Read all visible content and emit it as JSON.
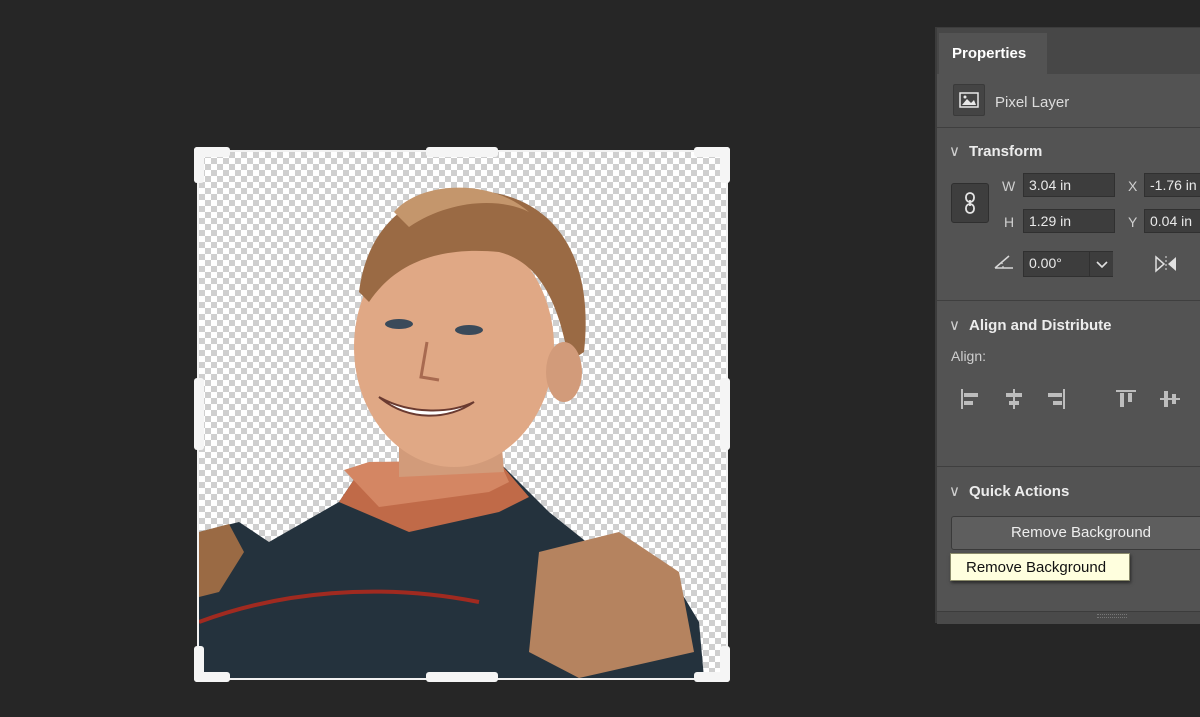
{
  "properties_panel": {
    "tab_label": "Properties",
    "layer_type": "Pixel Layer",
    "transform": {
      "title": "Transform",
      "w_label": "W",
      "w_value": "3.04 in",
      "h_label": "H",
      "h_value": "1.29 in",
      "x_label": "X",
      "x_value": "-1.76 in",
      "y_label": "Y",
      "y_value": "0.04 in",
      "angle_value": "0.00°"
    },
    "align": {
      "title": "Align and Distribute",
      "label": "Align:"
    },
    "quick_actions": {
      "title": "Quick Actions",
      "button_label": "Remove Background",
      "tooltip": "Remove Background"
    }
  },
  "icons": [
    "pixel-layer-icon",
    "chevron-down-icon",
    "link-icon",
    "angle-icon",
    "flip-horizontal-icon",
    "align-left-icon",
    "align-center-icon",
    "align-right-icon",
    "align-top-icon",
    "align-middle-icon"
  ]
}
